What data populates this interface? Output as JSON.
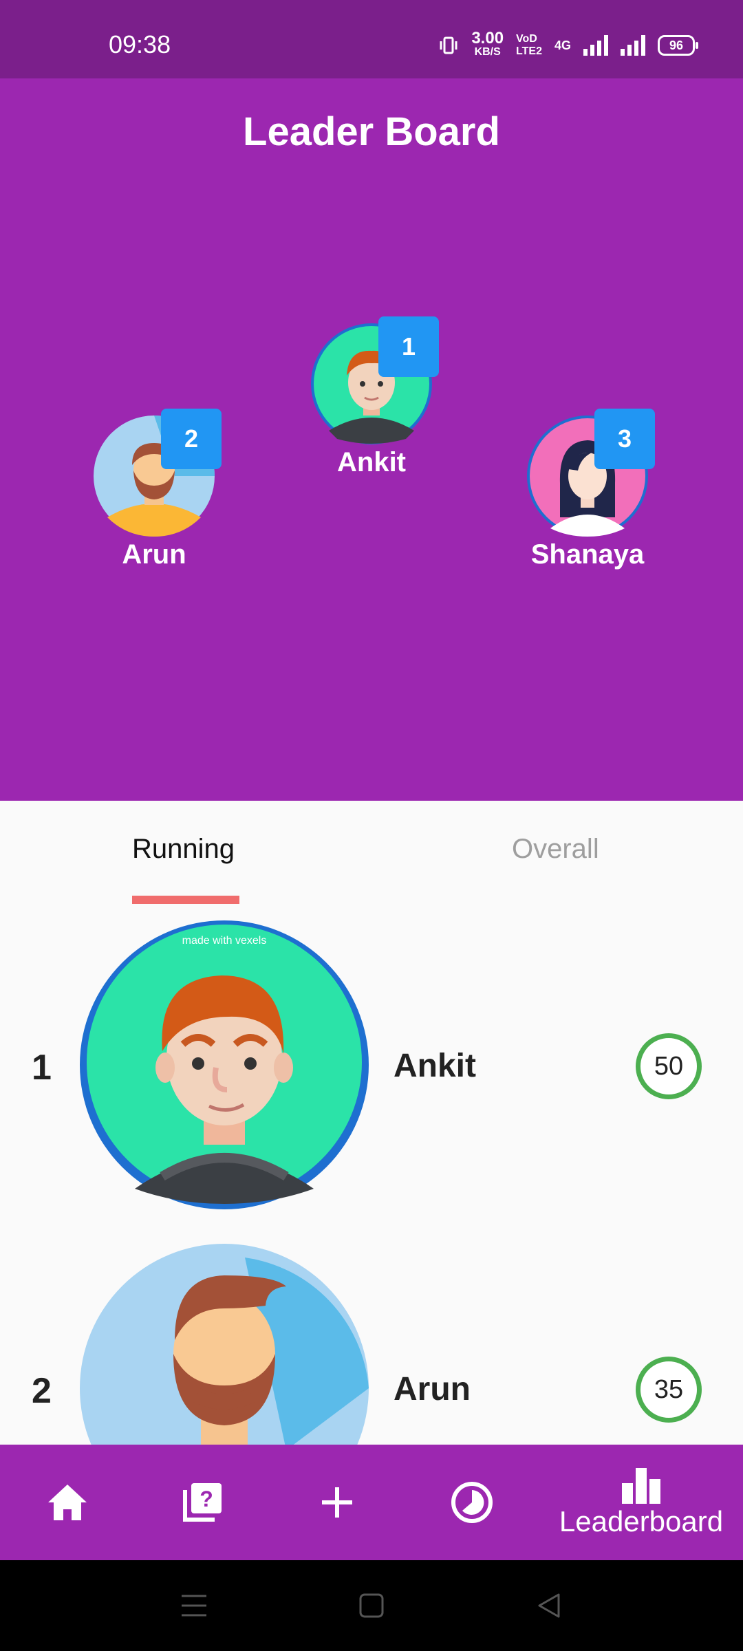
{
  "status_bar": {
    "time": "09:38",
    "net_speed_value": "3.00",
    "net_speed_unit": "KB/S",
    "volte_top": "VoD",
    "volte_bottom": "LTE2",
    "network": "4G",
    "battery": "96"
  },
  "header": {
    "title": "Leader Board"
  },
  "podium": [
    {
      "rank": "1",
      "name": "Ankit"
    },
    {
      "rank": "2",
      "name": "Arun"
    },
    {
      "rank": "3",
      "name": "Shanaya"
    }
  ],
  "tabs": {
    "running": "Running",
    "overall": "Overall"
  },
  "leaderboard": [
    {
      "rank": "1",
      "name": "Ankit",
      "score": "50"
    },
    {
      "rank": "2",
      "name": "Arun",
      "score": "35"
    }
  ],
  "avatar_watermark": "made with  vexels",
  "bottom_nav": {
    "items": [
      "home-icon",
      "quiz-icon",
      "add-icon",
      "history-icon",
      "leaderboard-icon"
    ],
    "active_label": "Leaderboard"
  },
  "colors": {
    "primary": "#9c27b0",
    "status_bar": "#7b1f8b",
    "badge": "#2196f3",
    "tab_indicator": "#f06c6c",
    "score_ring": "#4caf50"
  }
}
